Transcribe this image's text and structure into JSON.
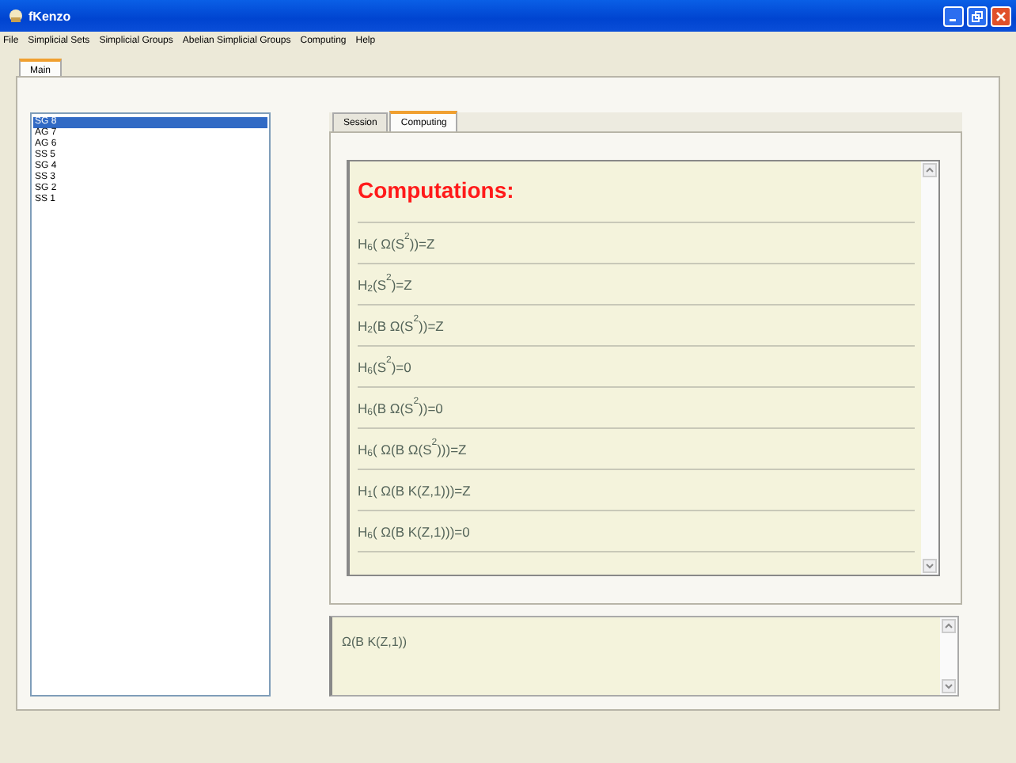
{
  "window": {
    "title": "fKenzo"
  },
  "menu": [
    "File",
    "Simplicial Sets",
    "Simplicial Groups",
    "Abelian Simplicial Groups",
    "Computing",
    "Help"
  ],
  "tabs": [
    {
      "label": "Main",
      "selected": true
    }
  ],
  "objects": [
    {
      "label": "SG 8",
      "selected": true
    },
    {
      "label": "AG 7",
      "selected": false
    },
    {
      "label": "AG 6",
      "selected": false
    },
    {
      "label": "SS 5",
      "selected": false
    },
    {
      "label": "SG 4",
      "selected": false
    },
    {
      "label": "SS 3",
      "selected": false
    },
    {
      "label": "SG 2",
      "selected": false
    },
    {
      "label": "SS 1",
      "selected": false
    }
  ],
  "inner_tabs": [
    {
      "label": "Session",
      "selected": false
    },
    {
      "label": "Computing",
      "selected": true
    }
  ],
  "computations": {
    "heading": "Computations:",
    "results": [
      "H$_{6}$( Ω(S$^{2}$))=Z",
      "H$_{2}$(S$^{2}$)=Z",
      "H$_{2}$(B Ω(S$^{2}$))=Z",
      "H$_{6}$(S$^{2}$)=0",
      "H$_{6}$(B Ω(S$^{2}$))=0",
      "H$_{6}$( Ω(B Ω(S$^{2}$)))=Z",
      "H$_{1}$( Ω(B K(Z,1)))=Z",
      "H$_{6}$( Ω(B K(Z,1)))=0"
    ]
  },
  "input": {
    "value": "Ω(B K(Z,1))"
  }
}
